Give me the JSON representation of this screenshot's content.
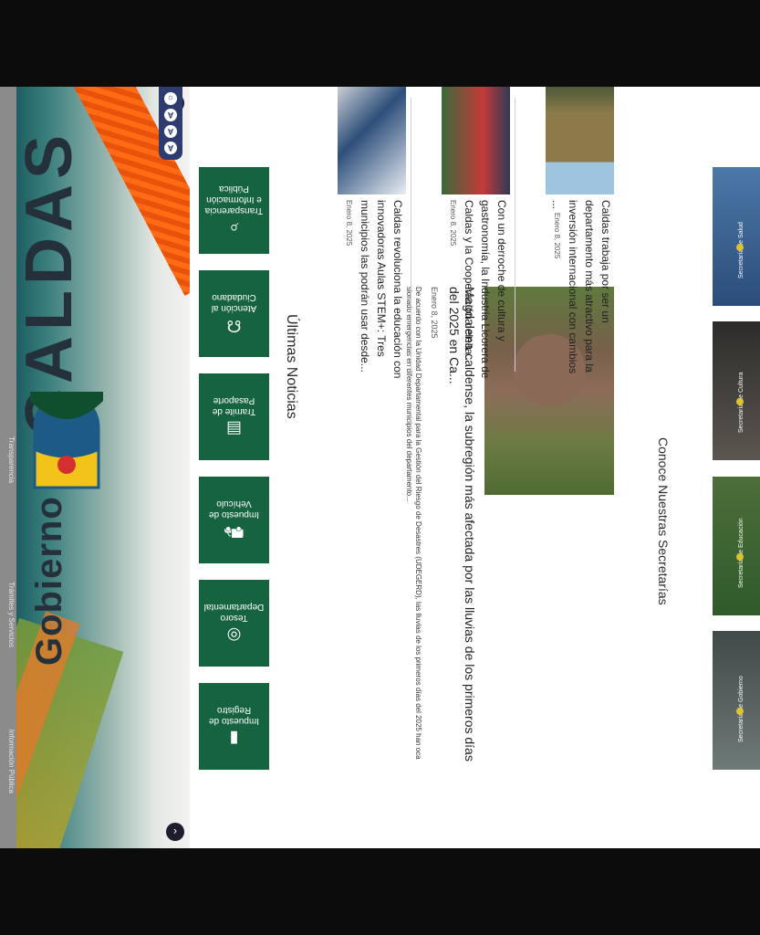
{
  "topbar": {
    "item1": "Información Pública",
    "item2": "Trámites y Servicios",
    "item3": "Transparencia"
  },
  "hero": {
    "title_line1": "Gobierno de",
    "title_line2": "CALDAS",
    "colors": {
      "teal": "#1e5e62",
      "orange": "#ff6a14",
      "dark_text": "#24313a"
    },
    "prev_icon": "chevron-left-icon",
    "next_icon": "chevron-right-icon",
    "accessibility": [
      "A",
      "A",
      "A",
      "☼"
    ]
  },
  "tiles": [
    {
      "icon": "▮",
      "label": "Impuesto de Registro"
    },
    {
      "icon": "◎",
      "label": "Tesoro Departamental"
    },
    {
      "icon": "⛟",
      "label": "Impuesto de Vehículo"
    },
    {
      "icon": "▤",
      "label": "Tramite de Pasaporte"
    },
    {
      "icon": "☊",
      "label": "Atención al Ciudadano"
    },
    {
      "icon": "⌕",
      "label": "Transparencia e Información Pública"
    }
  ],
  "news": {
    "section_title": "Últimas Noticias",
    "featured": {
      "title": "Magdalena caldense, la subregión más afectada por las lluvias de los primeros días del 2025 en Ca...",
      "date": "Enero 8, 2025",
      "body": "De acuerdo con la Unidad Departamental para la Gestión del Riesgo de Desastres (UDEGERD), las lluvias de los primeros días del 2025 han ocasionado emergencias en diferentes municipios del departamento..."
    },
    "items": [
      {
        "title": "Caldas revoluciona la educación con innovadoras Aulas STEM+: Tres municipios las podrán usar desde...",
        "date": "Enero 8, 2025"
      },
      {
        "title": "Con un derroche de cultura y gastronomía, la Industria Licorera de Caldas y la Cooperación deleita...",
        "date": "Enero 8, 2025"
      },
      {
        "title": "Caldas trabaja por ser un departamento más atractivo para la inversión internacional con cambios ...",
        "date": "Enero 8, 2025"
      }
    ]
  },
  "secretarias": {
    "section_title": "Conoce Nuestras Secretarías",
    "cards": [
      {
        "name": "Secretaría de Gobierno"
      },
      {
        "name": "Secretaría de Educación"
      },
      {
        "name": "Secretaría de Cultura"
      },
      {
        "name": "Secretaría de Salud"
      }
    ]
  }
}
